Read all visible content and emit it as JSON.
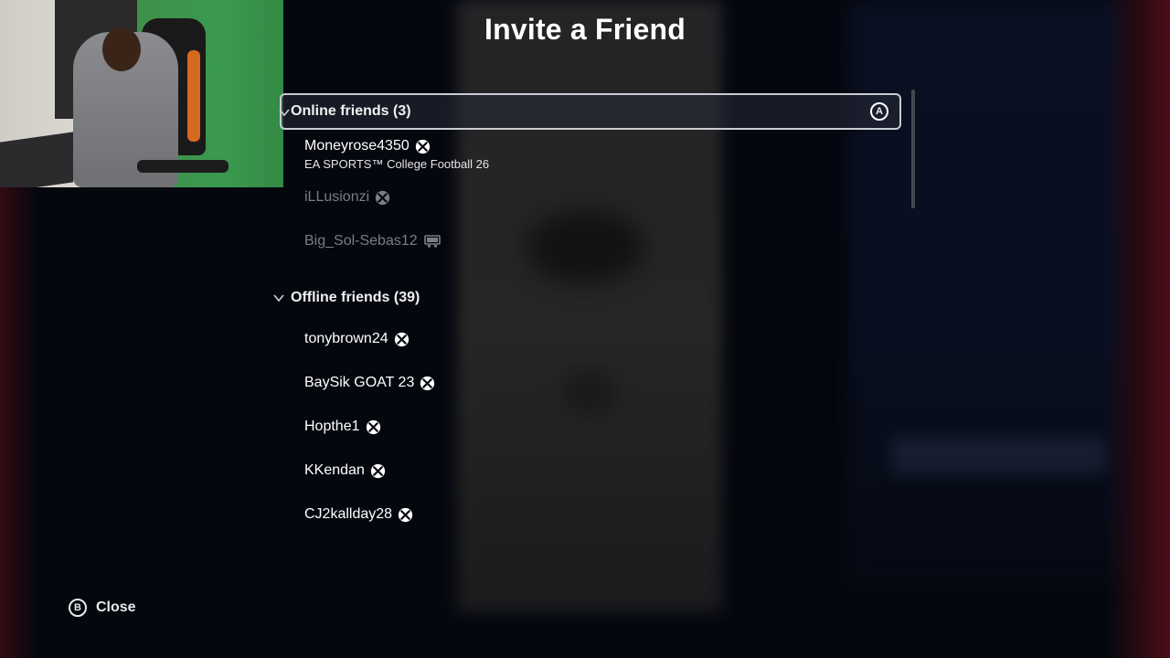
{
  "title": "Invite a Friend",
  "online": {
    "label": "Online friends (3)",
    "friends": [
      {
        "name": "Moneyrose4350",
        "status": "EA SPORTS™ College Football 26",
        "platform": "xbox-icon",
        "dimmed": false
      },
      {
        "name": "iLLusionzi",
        "status": "",
        "platform": "xbox-icon",
        "dimmed": true
      },
      {
        "name": "Big_Sol-Sebas12",
        "status": "",
        "platform": "computer-icon",
        "dimmed": true
      }
    ]
  },
  "offline": {
    "label": "Offline friends (39)",
    "friends": [
      {
        "name": "tonybrown24",
        "platform": "xbox-icon"
      },
      {
        "name": "BaySik GOAT 23",
        "platform": "xbox-icon"
      },
      {
        "name": "Hopthe1",
        "platform": "xbox-icon"
      },
      {
        "name": "KKendan",
        "platform": "xbox-icon"
      },
      {
        "name": "CJ2kallday28",
        "platform": "xbox-icon"
      }
    ]
  },
  "buttons": {
    "a_glyph": "A",
    "b_glyph": "B",
    "close_label": "Close"
  },
  "colors": {
    "background": "#05070f",
    "selected_border": "#c9ccd2",
    "dimmed_text": "#7b7d83"
  }
}
